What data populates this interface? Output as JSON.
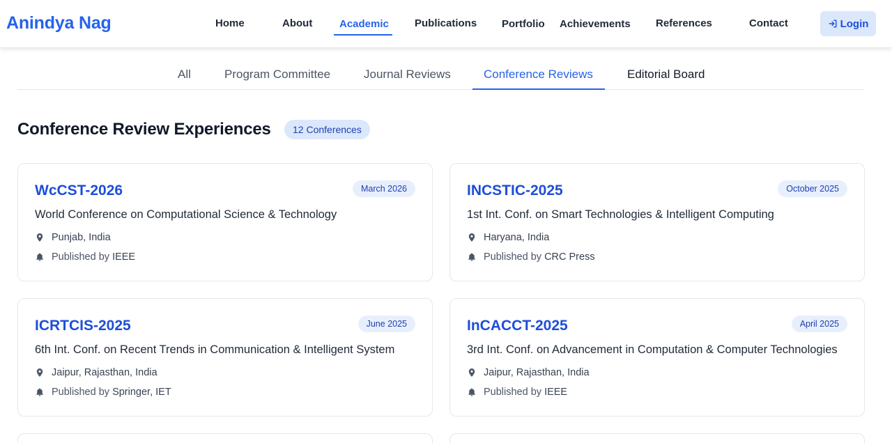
{
  "brand": "Anindya Nag",
  "nav": {
    "items": [
      "Home",
      "About",
      "Academic",
      "Publications",
      "Portfolio",
      "Achievements",
      "References",
      "Contact"
    ],
    "active": "Academic",
    "login_label": "Login"
  },
  "tabs": {
    "items": [
      "All",
      "Program Committee",
      "Journal Reviews",
      "Conference Reviews",
      "Editorial Board"
    ],
    "active": "Conference Reviews"
  },
  "section": {
    "title": "Conference Review Experiences",
    "count_badge": "12 Conferences"
  },
  "published_prefix": "Published by",
  "cards": [
    {
      "acronym": "WcCST-2026",
      "date": "March 2026",
      "name": "World Conference on Computational Science & Technology",
      "location": "Punjab, India",
      "publisher": "IEEE"
    },
    {
      "acronym": "INCSTIC-2025",
      "date": "October 2025",
      "name": "1st Int. Conf. on Smart Technologies & Intelligent Computing",
      "location": "Haryana, India",
      "publisher": "CRC Press"
    },
    {
      "acronym": "ICRTCIS-2025",
      "date": "June 2025",
      "name": "6th Int. Conf. on Recent Trends in Communication & Intelligent System",
      "location": "Jaipur, Rajasthan, India",
      "publisher": "Springer, IET"
    },
    {
      "acronym": "InCACCT-2025",
      "date": "April 2025",
      "name": "3rd Int. Conf. on Advancement in Computation & Computer Technologies",
      "location": "Jaipur, Rajasthan, India",
      "publisher": "IEEE"
    }
  ],
  "icons": {
    "location": "map-pin-icon",
    "publisher": "bell-icon",
    "login": "login-arrow-icon"
  },
  "colors": {
    "accent": "#2563eb",
    "badge_bg": "#dbe7fb"
  }
}
